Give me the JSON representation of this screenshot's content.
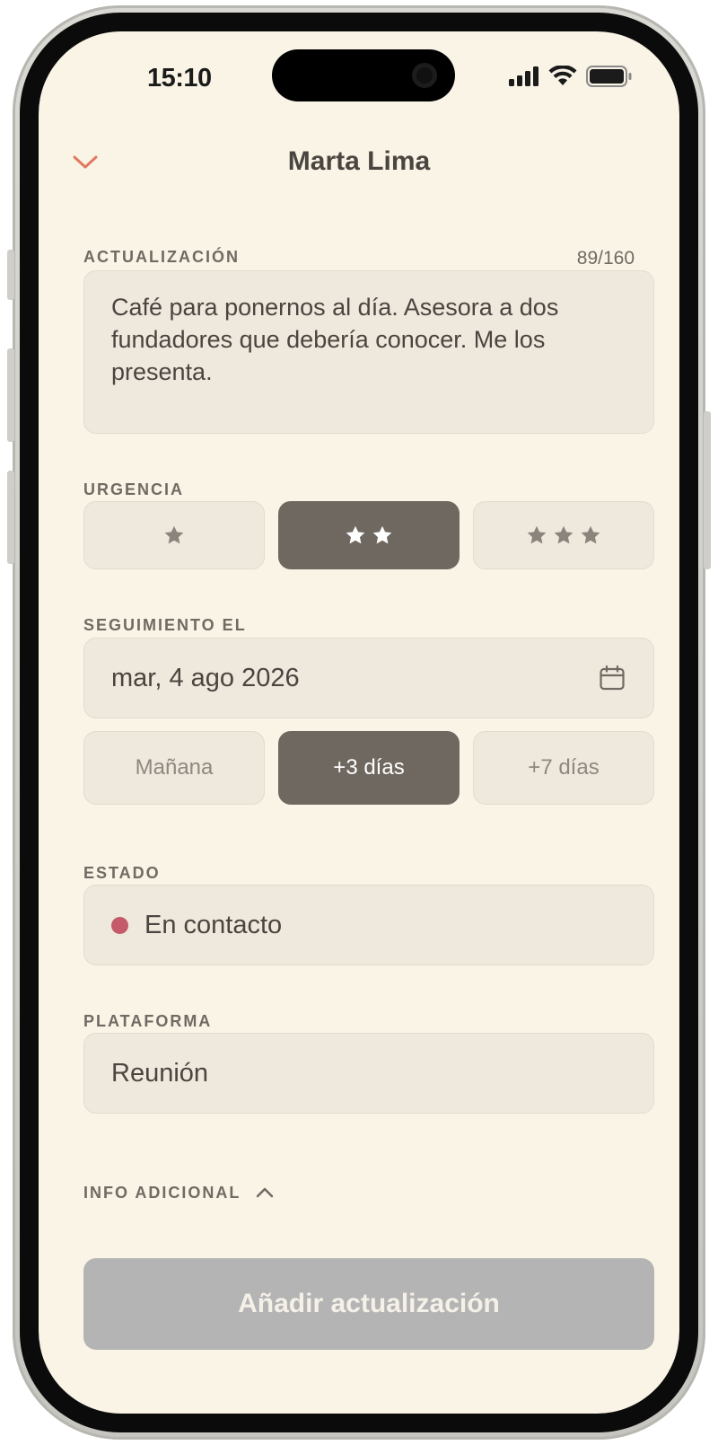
{
  "status_bar": {
    "time": "15:10"
  },
  "header": {
    "title": "Marta Lima"
  },
  "update": {
    "label": "ACTUALIZACIÓN",
    "counter": "89/160",
    "text": "Café para ponernos al día. Asesora a dos fundadores que debería conocer. Me los presenta."
  },
  "urgency": {
    "label": "URGENCIA",
    "options": [
      1,
      2,
      3
    ],
    "selected": 2
  },
  "followup": {
    "label": "SEGUIMIENTO EL",
    "date": "mar, 4 ago 2026",
    "quick_options": [
      "Mañana",
      "+3 días",
      "+7 días"
    ],
    "selected": "+3 días"
  },
  "state": {
    "label": "ESTADO",
    "value": "En contacto",
    "dot_color": "#c55a6a"
  },
  "platform": {
    "label": "PLATAFORMA",
    "value": "Reunión"
  },
  "extra": {
    "label": "INFO ADICIONAL"
  },
  "submit": {
    "label": "Añadir actualización"
  },
  "colors": {
    "accent": "#e07a5f",
    "background": "#faf4e6",
    "field": "#efe8dc",
    "selected": "#6f6860",
    "disabled_button": "#b4b4b4"
  }
}
